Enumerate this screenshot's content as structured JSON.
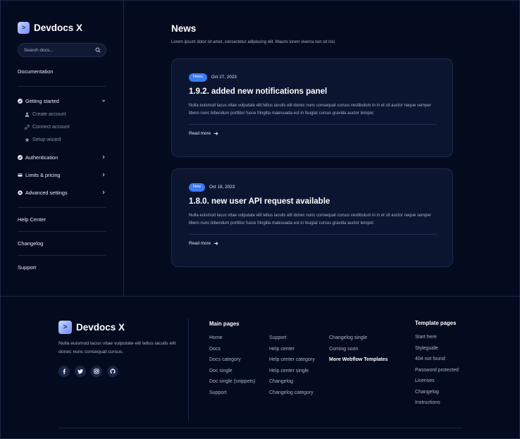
{
  "brand": {
    "name": "Devdocs X",
    "logo_glyph": ">"
  },
  "search": {
    "placeholder": "Search docs..."
  },
  "sidebar": {
    "documentation": "Documentation",
    "getting_started": {
      "label": "Getting started",
      "subitems": [
        "Create account",
        "Connect account",
        "Setup wizard"
      ]
    },
    "groups": [
      "Authentication",
      "Limits & pricing",
      "Advanced settings"
    ],
    "help_center": "Help Center",
    "changelog": "Changelog",
    "support": "Support"
  },
  "main": {
    "title": "News",
    "subtitle": "Lorem ipsum dolor sit amet, consectetur adipiscing elit. Mauris lorem viverra non sit nisi",
    "cards": [
      {
        "badge": "News",
        "date": "Oct 27, 2023",
        "title": "1.9.2. added new notifications panel",
        "body": "Nulla euismod lacus vitae vulputate elit tellus iaculis elit donec nunc consequat cursus vestibulum in in et sit auctor neque semper libero nunc bibendum porttitor fusce fringilla malesuada est in feugiat cursus gravida auctor tempor.",
        "read_more": "Read more"
      },
      {
        "badge": "New",
        "date": "Oct 18, 2023",
        "title": "1.8.0. new user API request available",
        "body": "Nulla euismod lacus vitae vulputate elit tellus iaculis elit donec nunc consequat cursus vestibulum in in et sit auctor neque semper libero nunc bibendum porttitor fusce fringilla malesuada est in feugiat cursus gravida auctor tempor.",
        "read_more": "Read more"
      }
    ]
  },
  "footer": {
    "brand": "Devdocs X",
    "description": "Nulla euismod lacus vitae vulputate elit tellus iaculis elit donec nunc consequat cursus.",
    "socials": [
      "facebook-icon",
      "twitter-icon",
      "instagram-icon",
      "github-icon"
    ],
    "main_pages_title": "Main pages",
    "main_col1": [
      "Home",
      "Docs",
      "Docs category",
      "Doc single",
      "Doc single (snippets)",
      "Support"
    ],
    "main_col2": [
      "Support",
      "Help center",
      "Help center category",
      "Help center single",
      "Changelog",
      "Changelog category"
    ],
    "main_col3": [
      "Changelog single",
      "Coming soon",
      "More Webflow Templates"
    ],
    "template_pages_title": "Template pages",
    "template_col": [
      "Start here",
      "Styleguide",
      "404 not found",
      "Password protected",
      "Licenses",
      "Changelog",
      "Instructions"
    ]
  },
  "colors": {
    "background": "#050b1f",
    "card": "#0c1530",
    "accent": "#3d7af5"
  }
}
